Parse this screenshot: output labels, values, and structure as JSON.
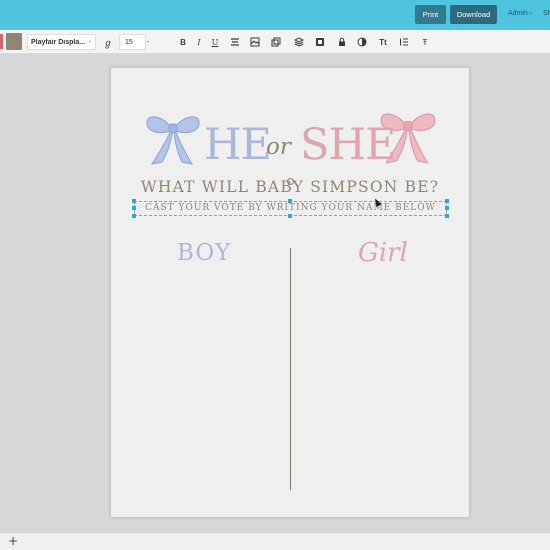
{
  "header": {
    "print_label": "Print",
    "download_label": "Download",
    "user_label": "Admin",
    "user_chevron": "⌄",
    "share_label": "Sh"
  },
  "toolbar": {
    "font_family_value": "Playfair Displa...",
    "font_size_value": "15",
    "chevron": "⌄",
    "tools": {
      "format_painter": "ℊ",
      "bold": "B",
      "italic": "I",
      "underline": "U",
      "case": "Tt",
      "list": "☰",
      "strikethrough": "Ŧ"
    },
    "colors": {
      "accent_red": "#d8646c",
      "text_color": "#8e8674"
    }
  },
  "document": {
    "title_he": "HE",
    "title_or": "or",
    "title_she": "SHE",
    "subtitle": "WHAT WILL BABY SIMPSON BE?",
    "instruction": "CAST YOUR VOTE BY WRITING YOUR NAME BELOW",
    "boy_label": "BOY",
    "girl_label": "Girl",
    "colors": {
      "blue": "#aab7d8",
      "pink": "#dfa5ad",
      "taupe": "#8d8672"
    }
  },
  "footer": {
    "add_label": "+"
  }
}
